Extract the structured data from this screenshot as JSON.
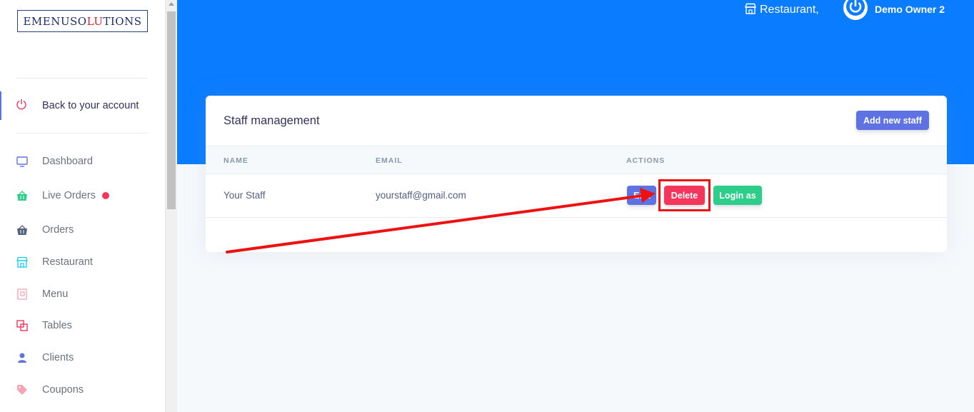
{
  "sidebar": {
    "logo": {
      "part1": "EMENUSO",
      "part2": "LU",
      "part3": "TIONS"
    },
    "back_label": "Back to your account",
    "items": [
      {
        "label": "Dashboard",
        "icon": "monitor-icon",
        "color": "#5e72e4"
      },
      {
        "label": "Live Orders",
        "icon": "basket-icon",
        "color": "#2dce89",
        "badge": "red-dot"
      },
      {
        "label": "Orders",
        "icon": "basket-icon",
        "color": "#525f7f"
      },
      {
        "label": "Restaurant",
        "icon": "store-icon",
        "color": "#11cdef"
      },
      {
        "label": "Menu",
        "icon": "book-icon",
        "color": "#f3a4b5"
      },
      {
        "label": "Tables",
        "icon": "squares-icon",
        "color": "#f5365c"
      },
      {
        "label": "Clients",
        "icon": "user-icon",
        "color": "#5e72e4"
      },
      {
        "label": "Coupons",
        "icon": "tag-icon",
        "color": "#f3a4b5"
      }
    ]
  },
  "topbar": {
    "restaurant_label": "Restaurant,",
    "user_name": "Demo Owner 2"
  },
  "card": {
    "title": "Staff management",
    "add_button": "Add new staff",
    "columns": [
      "NAME",
      "EMAIL",
      "ACTIONS"
    ],
    "rows": [
      {
        "name": "Your Staff",
        "email": "yourstaff@gmail.com",
        "edit": "Edit",
        "delete": "Delete",
        "login": "Login as"
      }
    ]
  },
  "colors": {
    "primary": "#5e72e4",
    "header_blue": "#0a7cff",
    "danger": "#f5365c",
    "success": "#2dce89",
    "annotation_red": "#ee1111"
  }
}
